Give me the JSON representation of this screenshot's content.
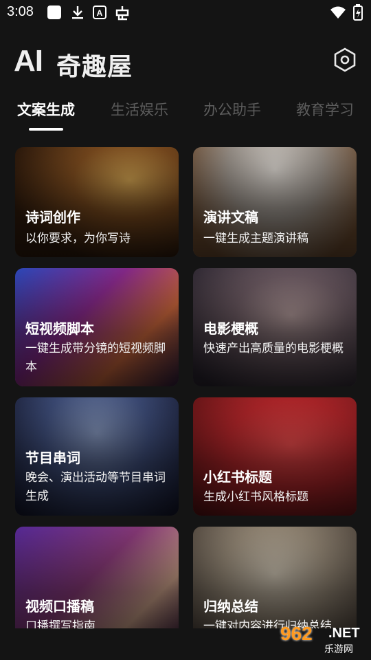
{
  "status_bar": {
    "time": "3:08"
  },
  "header": {
    "logo_ai": "AI",
    "logo_cn": "奇趣屋"
  },
  "tabs": [
    {
      "label": "文案生成",
      "active": true
    },
    {
      "label": "生活娱乐",
      "active": false
    },
    {
      "label": "办公助手",
      "active": false
    },
    {
      "label": "教育学习",
      "active": false
    }
  ],
  "cards": [
    {
      "title": "诗词创作",
      "desc": "以你要求，为你写诗"
    },
    {
      "title": "演讲文稿",
      "desc": "一键生成主题演讲稿"
    },
    {
      "title": "短视频脚本",
      "desc": "一键生成带分镜的短视频脚本"
    },
    {
      "title": "电影梗概",
      "desc": "快速产出高质量的电影梗概"
    },
    {
      "title": "节目串词",
      "desc": "晚会、演出活动等节目串词生成"
    },
    {
      "title": "小红书标题",
      "desc": "生成小红书风格标题"
    },
    {
      "title": "视频口播稿",
      "desc": "口播撰写指南"
    },
    {
      "title": "归纳总结",
      "desc": "一键对内容进行归纳总结"
    }
  ],
  "watermark": {
    "number": "962",
    "suffix": ".NET",
    "name": "乐游网"
  }
}
